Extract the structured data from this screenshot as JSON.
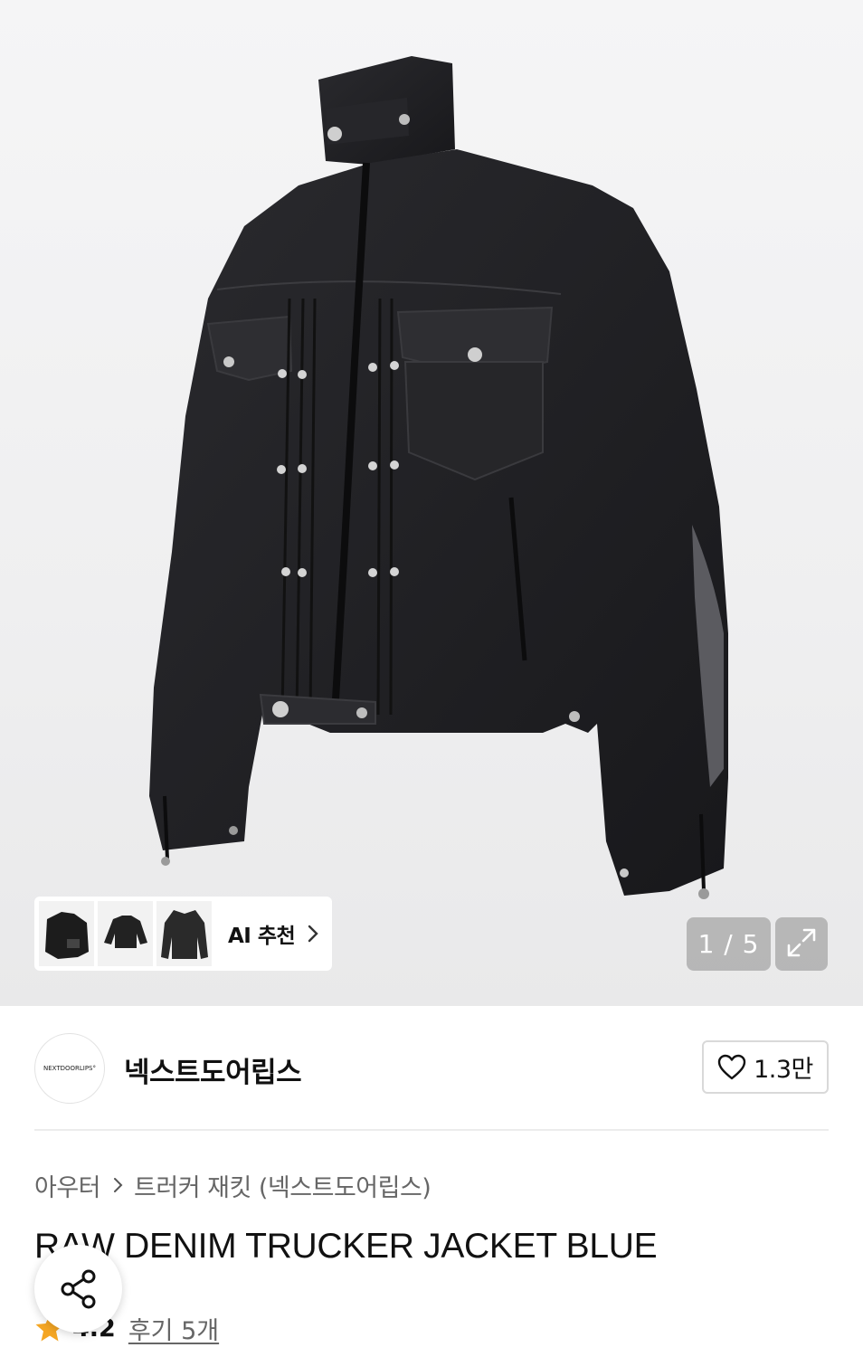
{
  "hero": {
    "ai_recommend_label": "AI 추천",
    "image_counter": "1 / 5",
    "thumbnails": [
      "thumbnail-1",
      "thumbnail-2",
      "thumbnail-3"
    ]
  },
  "brand": {
    "logo_text": "NEXTDOORLIPS°",
    "name": "넥스트도어립스",
    "like_count": "1.3만"
  },
  "breadcrumb": {
    "category": "아우터",
    "subcategory": "트러커 재킷 (넥스트도어립스)"
  },
  "product": {
    "title": "RAW DENIM TRUCKER JACKET BLUE"
  },
  "rating": {
    "score": "4.2",
    "reviews_label": "후기 5개"
  },
  "colors": {
    "star": "#F5A623",
    "jacket": "#1f1f22",
    "chip_bg": "#ffffff"
  },
  "icons": [
    "chevron-right-icon",
    "expand-icon",
    "heart-icon",
    "share-icon",
    "star-icon"
  ]
}
